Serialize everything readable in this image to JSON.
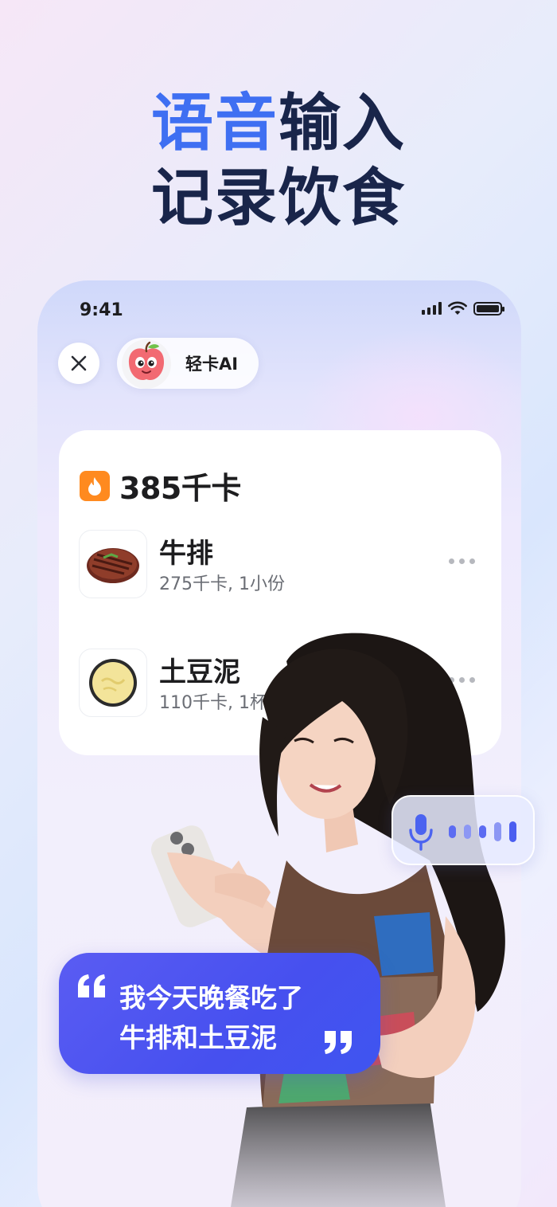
{
  "headline": {
    "accent": "语音",
    "line1_rest": "输入",
    "line2": "记录饮食"
  },
  "colors": {
    "accent": "#3f6ff2",
    "headline": "#19254a",
    "bubble": "#4c55f0",
    "fire": "#ff8a1f"
  },
  "status_bar": {
    "time": "9:41",
    "icons": [
      "signal-icon",
      "wifi-icon",
      "battery-icon"
    ]
  },
  "top_bar": {
    "close_icon": "close-icon",
    "assistant_name": "轻卡AI",
    "assistant_avatar": "apple-mascot"
  },
  "meal_card": {
    "total_kcal": "385千卡",
    "items": [
      {
        "name": "牛排",
        "meta": "275千卡, 1小份",
        "thumb": "steak-image"
      },
      {
        "name": "土豆泥",
        "meta": "110千卡, 1杯",
        "thumb": "mashed-potato-image"
      }
    ]
  },
  "voice_input": {
    "icon": "microphone-icon"
  },
  "speech": {
    "line1": "我今天晚餐吃了",
    "line2": "牛排和土豆泥"
  }
}
